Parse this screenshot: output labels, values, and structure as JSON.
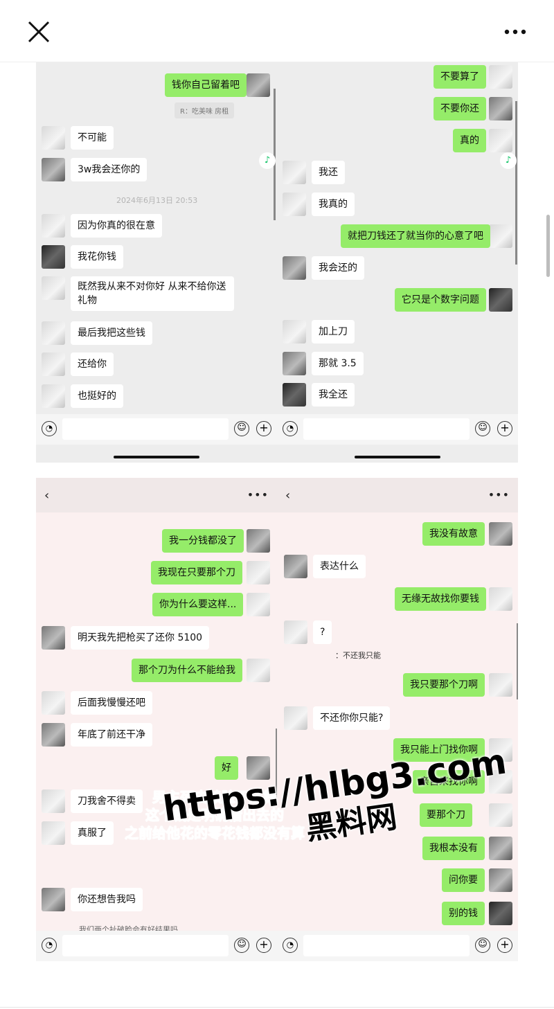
{
  "topbar": {
    "close_icon": "close-icon",
    "more_icon": "more-icon"
  },
  "top_left": {
    "quote": "R：吃美味 房租",
    "timestamp": "2024年6月13日 20:53",
    "messages": [
      "钱你自己留着吧",
      "不可能",
      "3w我会还你的",
      "因为你真的很在意",
      "我花你钱",
      "既然我从来不对你好 从来不给你送礼物",
      "最后我把这些钱",
      "还给你",
      "也挺好的"
    ]
  },
  "top_right": {
    "messages": [
      "不要算了",
      "不要你还",
      "真的",
      "我还",
      "我真的",
      "就把刀钱还了就当你的心意了吧",
      "我会还的",
      "它只是个数字问题",
      "加上刀",
      "那就 3.5",
      "我全还"
    ]
  },
  "bottom_left": {
    "messages": [
      "我一分钱都没了",
      "我现在只要那个刀",
      "你为什么要这样...",
      "明天我先把枪买了还你 5100",
      "那个刀为什么不能给我",
      "后面我慢慢还吧",
      "年底了前还干净",
      "好",
      "刀我舍不得卖",
      "真服了",
      "你还想告我吗",
      "我们两个扯破脸会有好结果吗"
    ]
  },
  "bottom_right": {
    "quote_label": "：不还我只能",
    "messages": [
      "我没有故意",
      "表达什么",
      "无缘无故找你要钱",
      "?",
      "我只要那个刀啊",
      "不还你你只能?",
      "我只能上门找你啊",
      "亲自来找你啊",
      "要那个刀",
      "我根本没有",
      "问你要",
      "别的钱"
    ]
  },
  "overlay_caption": [
    "男主死皮赖脸不还钱",
    "这个钱是明确借出去的",
    "之前给他花的零花钱都没有算"
  ],
  "watermark": {
    "url": "https://hlbg3.com",
    "site": "黑料网"
  },
  "colors": {
    "outgoing_bubble": "#95ec69",
    "incoming_bubble": "#ffffff",
    "caption_pink": "#e75a7c"
  }
}
